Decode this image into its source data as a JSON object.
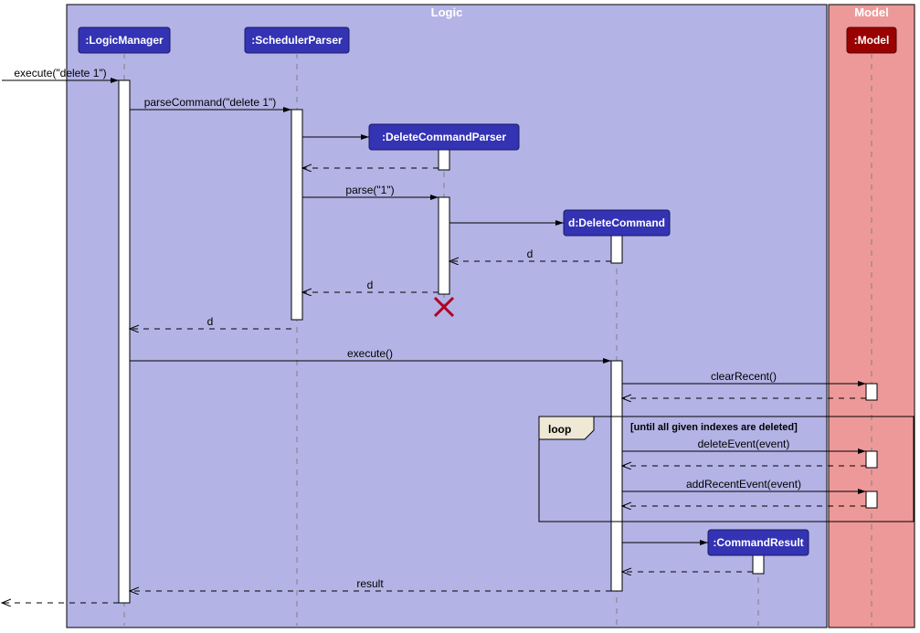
{
  "diagram": {
    "type": "UML Sequence Diagram",
    "frames": {
      "logic": "Logic",
      "model": "Model"
    },
    "participants": {
      "logicManager": ":LogicManager",
      "schedulerParser": ":SchedulerParser",
      "deleteCommandParser": ":DeleteCommandParser",
      "deleteCommand": "d:DeleteCommand",
      "commandResult": ":CommandResult",
      "model": ":Model"
    },
    "messages": {
      "execute_in": "execute(\"delete 1\")",
      "parseCommand": "parseCommand(\"delete 1\")",
      "parse": "parse(\"1\")",
      "return_d1": "d",
      "return_d2": "d",
      "return_d3": "d",
      "execute": "execute()",
      "clearRecent": "clearRecent()",
      "deleteEvent": "deleteEvent(event)",
      "addRecentEvent": "addRecentEvent(event)",
      "result": "result"
    },
    "fragments": {
      "loop_label": "loop",
      "loop_guard": "[until all given indexes are deleted]"
    }
  }
}
